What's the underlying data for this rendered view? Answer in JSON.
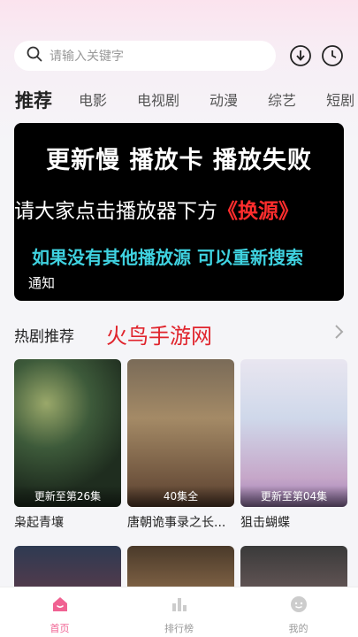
{
  "search": {
    "placeholder": "请输入关键字"
  },
  "header_icons": [
    "download-icon",
    "history-clock-icon"
  ],
  "tabs": [
    {
      "label": "推荐",
      "active": true
    },
    {
      "label": "电影"
    },
    {
      "label": "电视剧"
    },
    {
      "label": "动漫"
    },
    {
      "label": "综艺"
    },
    {
      "label": "短剧"
    }
  ],
  "banner": {
    "line1": "更新慢 播放卡 播放失败",
    "line2_prefix": "请大家点击播放器下方",
    "line2_highlight": "《换源》",
    "line3": "如果没有其他播放源 可以重新搜索",
    "line4": "通知"
  },
  "section": {
    "title": "热剧推荐",
    "watermark": "火鸟手游网"
  },
  "cards": [
    {
      "title": "枭起青壤",
      "episode": "更新至第26集"
    },
    {
      "title": "唐朝诡事录之长...",
      "episode": "40集全"
    },
    {
      "title": "狙击蝴蝶",
      "episode": "更新至第04集"
    }
  ],
  "bottom_nav": [
    {
      "label": "首页",
      "icon": "home-icon",
      "active": true
    },
    {
      "label": "排行榜",
      "icon": "ranking-icon"
    },
    {
      "label": "我的",
      "icon": "profile-icon"
    }
  ],
  "colors": {
    "accent": "#f06292",
    "highlight_red": "#ff2d2d",
    "banner_cyan": "#3fd2e0"
  }
}
